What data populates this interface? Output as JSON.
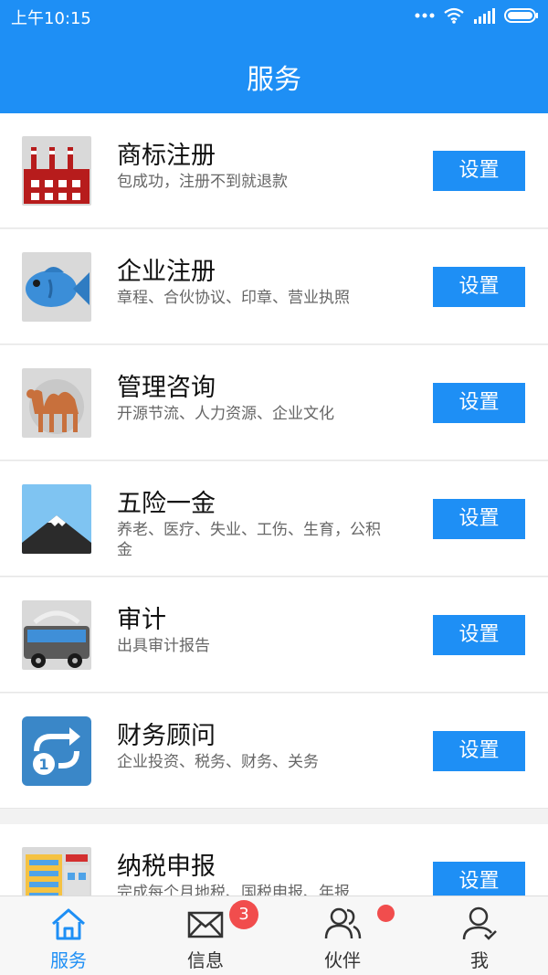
{
  "status_bar": {
    "time": "上午10:15"
  },
  "header": {
    "title": "服务"
  },
  "services": [
    {
      "name": "商标注册",
      "description": "包成功，注册不到就退款",
      "button": "设置",
      "icon": "factory-icon"
    },
    {
      "name": "企业注册",
      "description": "章程、合伙协议、印章、营业执照",
      "button": "设置",
      "icon": "fish-icon"
    },
    {
      "name": "管理咨询",
      "description": "开源节流、人力资源、企业文化",
      "button": "设置",
      "icon": "camel-icon"
    },
    {
      "name": "五险一金",
      "description": "养老、医疗、失业、工伤、生育，公积金",
      "button": "设置",
      "icon": "mountain-icon"
    },
    {
      "name": "审计",
      "description": "出具审计报告",
      "button": "设置",
      "icon": "bus-icon"
    },
    {
      "name": "财务顾问",
      "description": "企业投资、税务、财务、关务",
      "button": "设置",
      "icon": "repeat-one-icon"
    },
    {
      "name": "纳税申报",
      "description": "完成每个月地税、国税申报、年报",
      "button": "设置",
      "icon": "building-icon"
    }
  ],
  "tabs": [
    {
      "label": "服务",
      "icon": "home-icon",
      "active": true
    },
    {
      "label": "信息",
      "icon": "mail-icon",
      "badge": "3"
    },
    {
      "label": "伙伴",
      "icon": "people-icon"
    },
    {
      "label": "我",
      "icon": "person-icon"
    }
  ],
  "colors": {
    "primary": "#1e8ff5",
    "badge": "#f14d4d"
  }
}
